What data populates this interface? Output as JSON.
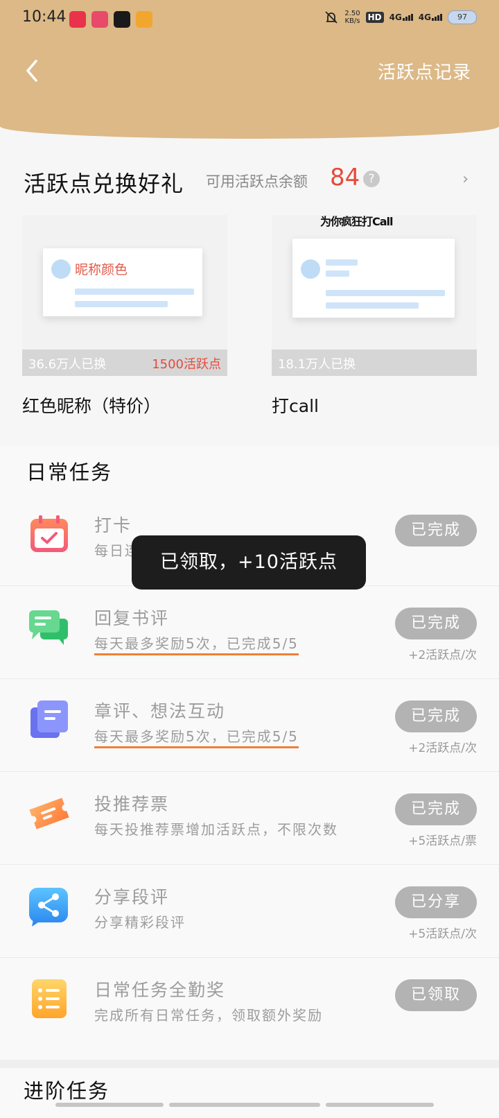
{
  "status_bar": {
    "time": "10:44",
    "speed_value": "2.50",
    "speed_unit": "KB/s",
    "hd_tag": "HD",
    "net1": "4G",
    "net2": "4G",
    "battery": "97"
  },
  "header": {
    "back_icon": "chevron-left-icon",
    "record_link": "活跃点记录"
  },
  "rewards": {
    "title": "活跃点兑换好礼",
    "balance_label": "可用活跃点余额",
    "balance": "84",
    "help": "?",
    "more_arrow": "›",
    "items": [
      {
        "preview_text": "昵称颜色",
        "count": "36.6万人已换",
        "price": "1500活跃点",
        "name": "红色昵称（特价）"
      },
      {
        "preview_text": "为你疯狂打Call",
        "count": "18.1万人已换",
        "price": "",
        "name": "打call"
      }
    ]
  },
  "daily": {
    "title": "日常任务",
    "tasks": [
      {
        "icon": "calendar-check-icon",
        "title": "打卡",
        "desc": "每日连续打卡可获得更多活跃点",
        "button": "已完成",
        "reward": ""
      },
      {
        "icon": "chat-bubbles-icon",
        "title": "回复书评",
        "desc": "每天最多奖励5次，已完成5/5",
        "button": "已完成",
        "reward": "+2活跃点/次"
      },
      {
        "icon": "document-icon",
        "title": "章评、想法互动",
        "desc": "每天最多奖励5次，已完成5/5",
        "button": "已完成",
        "reward": "+2活跃点/次"
      },
      {
        "icon": "ticket-icon",
        "title": "投推荐票",
        "desc": "每天投推荐票增加活跃点，不限次数",
        "button": "已完成",
        "reward": "+5活跃点/票"
      },
      {
        "icon": "share-icon",
        "title": "分享段评",
        "desc": "分享精彩段评",
        "button": "已分享",
        "reward": "+5活跃点/次"
      },
      {
        "icon": "list-icon",
        "title": "日常任务全勤奖",
        "desc": "完成所有日常任务，领取额外奖励",
        "button": "已领取",
        "reward": ""
      }
    ]
  },
  "advanced": {
    "title": "进阶任务"
  },
  "toast": {
    "text": "已领取，+10活跃点"
  },
  "colors": {
    "header": "#dcb987",
    "accent": "#e64a3b",
    "button": "#b3b3b3"
  }
}
